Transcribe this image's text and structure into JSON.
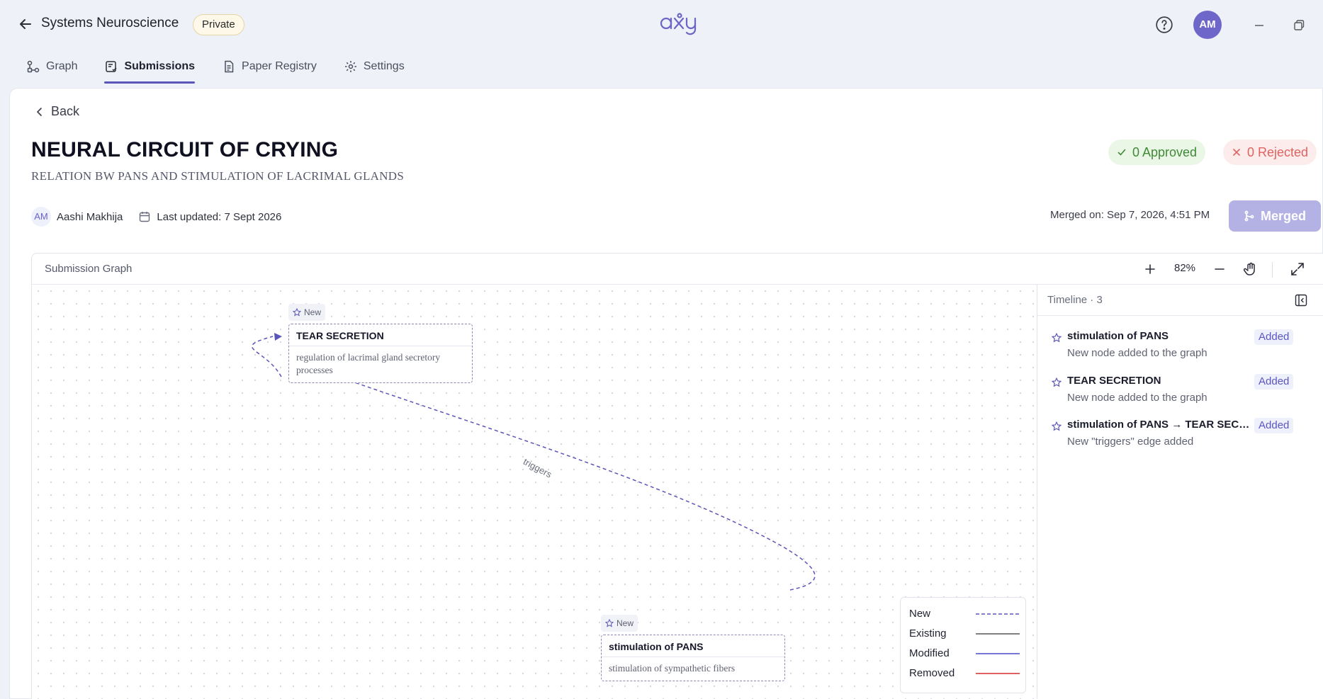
{
  "header": {
    "workspace_title": "Systems Neuroscience",
    "visibility": "Private",
    "logo_text": "axy",
    "user_initials": "AM"
  },
  "tabs": [
    {
      "label": "Graph",
      "icon": "graph-icon"
    },
    {
      "label": "Submissions",
      "icon": "submissions-icon",
      "active": true
    },
    {
      "label": "Paper Registry",
      "icon": "paper-icon"
    },
    {
      "label": "Settings",
      "icon": "gear-icon"
    }
  ],
  "submission": {
    "back_label": "Back",
    "title": "NEURAL CIRCUIT OF CRYING",
    "subtitle": "RELATION BW PANS AND STIMULATION OF LACRIMAL GLANDS",
    "approved": "0 Approved",
    "rejected": "0 Rejected",
    "author_initials": "AM",
    "author": "Aashi Makhija",
    "last_updated": "Last updated: 7 Sept 2026",
    "merged_on": "Merged on: Sep 7, 2026, 4:51 PM",
    "merged_label": "Merged"
  },
  "graph": {
    "title": "Submission Graph",
    "zoom": "82%",
    "nodes": [
      {
        "tag": "New",
        "title": "TEAR SECRETION",
        "description": "regulation of lacrimal gland secretory processes"
      },
      {
        "tag": "New",
        "title": "stimulation of PANS",
        "description": "stimulation of sympathetic fibers"
      }
    ],
    "edge_label": "triggers",
    "legend": [
      {
        "label": "New",
        "color": "#5a55b8",
        "style": "dashed"
      },
      {
        "label": "Existing",
        "color": "#555555",
        "style": "solid"
      },
      {
        "label": "Modified",
        "color": "#4b49c8",
        "style": "solid"
      },
      {
        "label": "Removed",
        "color": "#d42b2b",
        "style": "solid"
      }
    ]
  },
  "timeline": {
    "title": "Timeline · 3",
    "items": [
      {
        "title": "stimulation of PANS",
        "description": "New node added to the graph",
        "badge": "Added"
      },
      {
        "title": "TEAR SECRETION",
        "description": "New node added to the graph",
        "badge": "Added"
      },
      {
        "title": "stimulation of PANS → TEAR SECRETION",
        "description": "New \"triggers\" edge added",
        "badge": "Added"
      }
    ]
  }
}
